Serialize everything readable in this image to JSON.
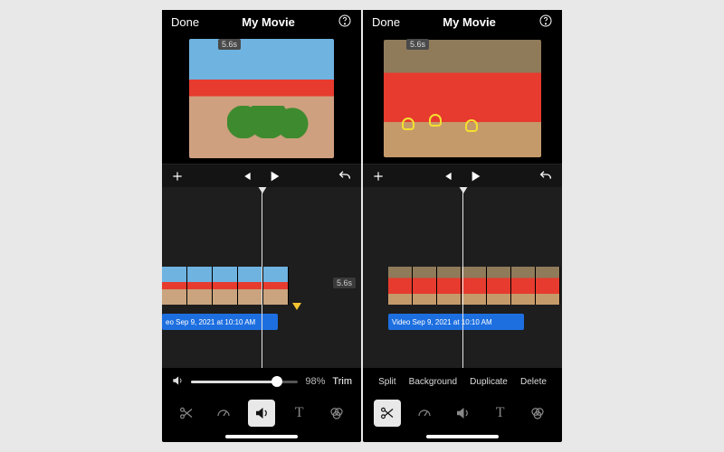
{
  "left": {
    "done": "Done",
    "title": "My Movie",
    "preview_duration": "5.6s",
    "timeline_duration": "5.6s",
    "audio_label": "eo Sep 9, 2021 at 10:10 AM",
    "volume_percent": "98%",
    "trim_label": "Trim",
    "tools": {
      "scissors": "scissors",
      "speed": "speedometer",
      "audio": "volume",
      "text": "T",
      "filters": "filters"
    },
    "active_tool": "audio"
  },
  "right": {
    "done": "Done",
    "title": "My Movie",
    "preview_duration": "5.6s",
    "audio_label": "Video Sep 9, 2021 at 10:10 AM",
    "context_menu": {
      "split": "Split",
      "background": "Background",
      "duplicate": "Duplicate",
      "delete": "Delete"
    },
    "tools": {
      "scissors": "scissors",
      "speed": "speedometer",
      "audio": "volume",
      "text": "T",
      "filters": "filters"
    },
    "active_tool": "scissors"
  },
  "icons": {
    "add": "plus",
    "skip_back": "skip-back",
    "play": "play",
    "undo": "undo",
    "help": "help",
    "volume": "speaker"
  }
}
